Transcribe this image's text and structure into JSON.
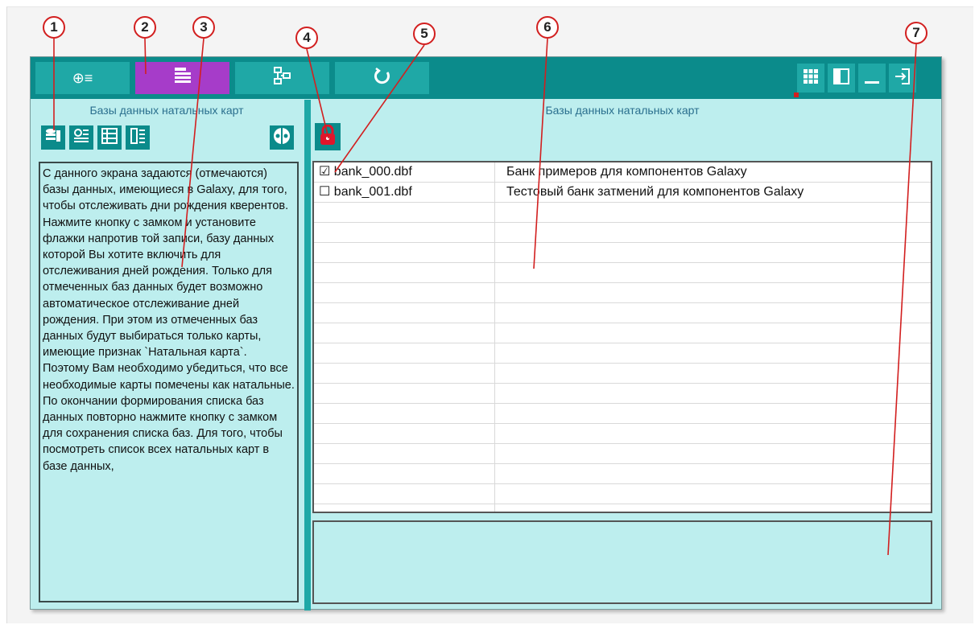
{
  "toolbar": {
    "tabs": [
      {
        "icon": "cross-circle-list-icon",
        "glyph": "⊕≡"
      },
      {
        "icon": "list-document-icon",
        "glyph": "≣"
      },
      {
        "icon": "tree-structure-icon",
        "glyph": "⚇"
      },
      {
        "icon": "refresh-icon",
        "glyph": "↻"
      }
    ],
    "active_tab": 1,
    "window_buttons": [
      "grid-view-icon",
      "panel-toggle-icon",
      "minimize-icon",
      "exit-icon"
    ]
  },
  "left_panel": {
    "title": "Базы данных натальных карт",
    "tool_buttons": [
      "database-list-icon",
      "add-chart-icon",
      "list-table-icon",
      "chart-details-icon"
    ],
    "special_button": "circle-mode-icon",
    "help_text": "С данного экрана задаются (отмечаются) базы данных, имеющиеся в Galaxy, для того, чтобы отслеживать дни рождения кверентов. Нажмите кнопку с замком и установите флажки напротив той записи, базу данных которой Вы хотите включить для отслеживания дней рождения. Только для отмеченных баз данных будет возможно автоматическое отслеживание дней рождения. При этом из отмеченных баз данных будут выбираться только карты, имеющие признак `Натальная карта`. Поэтому Вам необходимо убедиться, что все необходимые карты помечены как натальные. По окончании формирования списка баз данных повторно нажмите кнопку с замком для сохранения списка баз. Для того, чтобы посмотреть список всех натальных карт в базе данных,"
  },
  "right_panel": {
    "title": "Базы данных натальных карт",
    "lock_button": "lock-icon",
    "rows": [
      {
        "checked": true,
        "file": "bank_000.dbf",
        "description": "Банк примеров для компонентов Galaxy"
      },
      {
        "checked": false,
        "file": "bank_001.dbf",
        "description": "Тестовый банк затмений для компонентов Galaxy"
      }
    ],
    "empty_rows": 16
  },
  "callouts": [
    "1",
    "2",
    "3",
    "4",
    "5",
    "6",
    "7"
  ],
  "colors": {
    "toolbar": "#0b8b8b",
    "tab": "#1fa8a6",
    "active_tab": "#a63cc9",
    "panel_bg": "#bdeeee",
    "title_text": "#2a6f8e",
    "callout": "#d21f1f",
    "lock": "#e0162b"
  }
}
